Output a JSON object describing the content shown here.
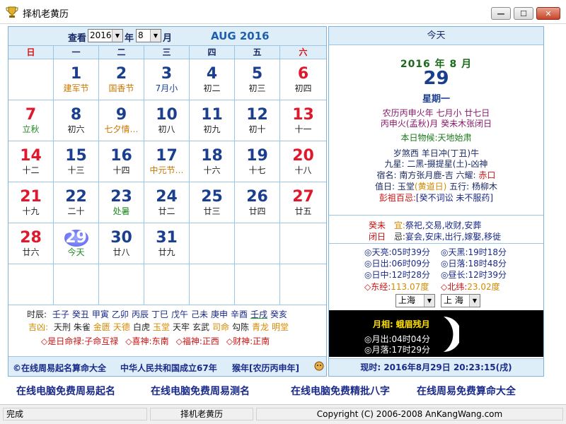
{
  "window": {
    "title": "择机老黄历",
    "min_glyph": "—",
    "max_glyph": "☐",
    "close_glyph": "✕"
  },
  "nav": {
    "view_label": "查看",
    "year_value": "2016",
    "year_unit": "年",
    "month_value": "8",
    "month_unit": "月",
    "month_title": "AUG 2016"
  },
  "weekdays": [
    "日",
    "一",
    "二",
    "三",
    "四",
    "五",
    "六"
  ],
  "calendar": [
    [
      {
        "d": "",
        "l": ""
      },
      {
        "d": "1",
        "l": "建军节",
        "k": "fest"
      },
      {
        "d": "2",
        "l": "国香节",
        "k": "fest"
      },
      {
        "d": "3",
        "l": "7月小",
        "k": "blue"
      },
      {
        "d": "4",
        "l": "初二"
      },
      {
        "d": "5",
        "l": "初三"
      },
      {
        "d": "6",
        "l": "初四"
      }
    ],
    [
      {
        "d": "7",
        "l": "立秋",
        "k": "term"
      },
      {
        "d": "8",
        "l": "初六"
      },
      {
        "d": "9",
        "l": "七夕情…",
        "k": "fest"
      },
      {
        "d": "10",
        "l": "初八"
      },
      {
        "d": "11",
        "l": "初九"
      },
      {
        "d": "12",
        "l": "初十"
      },
      {
        "d": "13",
        "l": "十一"
      }
    ],
    [
      {
        "d": "14",
        "l": "十二"
      },
      {
        "d": "15",
        "l": "十三"
      },
      {
        "d": "16",
        "l": "十四"
      },
      {
        "d": "17",
        "l": "中元节…",
        "k": "fest"
      },
      {
        "d": "18",
        "l": "十六"
      },
      {
        "d": "19",
        "l": "十七"
      },
      {
        "d": "20",
        "l": "十八"
      }
    ],
    [
      {
        "d": "21",
        "l": "十九"
      },
      {
        "d": "22",
        "l": "二十"
      },
      {
        "d": "23",
        "l": "处暑",
        "k": "term"
      },
      {
        "d": "24",
        "l": "廿二"
      },
      {
        "d": "25",
        "l": "廿三"
      },
      {
        "d": "26",
        "l": "廿四"
      },
      {
        "d": "27",
        "l": "廿五"
      }
    ],
    [
      {
        "d": "28",
        "l": "廿六"
      },
      {
        "d": "29",
        "l": "今天",
        "k": "term",
        "today": true
      },
      {
        "d": "30",
        "l": "廿八"
      },
      {
        "d": "31",
        "l": "廿九"
      },
      {
        "d": "",
        "l": ""
      },
      {
        "d": "",
        "l": ""
      },
      {
        "d": "",
        "l": ""
      }
    ],
    [
      {
        "d": "",
        "l": ""
      },
      {
        "d": "",
        "l": ""
      },
      {
        "d": "",
        "l": ""
      },
      {
        "d": "",
        "l": ""
      },
      {
        "d": "",
        "l": ""
      },
      {
        "d": "",
        "l": ""
      },
      {
        "d": "",
        "l": ""
      }
    ]
  ],
  "hours": {
    "row1_label": "时辰:",
    "row1": [
      "壬子",
      "癸丑",
      "甲寅",
      "乙卯",
      "丙辰",
      "丁巳",
      "戊午",
      "己未",
      "庚申",
      "辛酉",
      "壬戌",
      "癸亥"
    ],
    "row2_label": "吉凶:",
    "row2": [
      {
        "t": "天刑",
        "c": "dark"
      },
      {
        "t": "朱雀",
        "c": "dark"
      },
      {
        "t": "金匮",
        "c": "gold"
      },
      {
        "t": "天德",
        "c": "gold"
      },
      {
        "t": "白虎",
        "c": "dark"
      },
      {
        "t": "玉堂",
        "c": "gold"
      },
      {
        "t": "天牢",
        "c": "dark"
      },
      {
        "t": "玄武",
        "c": "dark"
      },
      {
        "t": "司命",
        "c": "gold"
      },
      {
        "t": "勾陈",
        "c": "dark"
      },
      {
        "t": "青龙",
        "c": "gold"
      },
      {
        "t": "明堂",
        "c": "gold"
      }
    ],
    "row3": [
      {
        "k": "◇是日命禄:",
        "v": "子命互禄"
      },
      {
        "k": "◇喜神:",
        "v": "东南"
      },
      {
        "k": "◇福神:",
        "v": "正西"
      },
      {
        "k": "◇财神:",
        "v": "正南"
      }
    ]
  },
  "left_footer": {
    "copy": "©在线周易起名算命大全",
    "mid": "中华人民共和国成立67年",
    "year": "猴年[农历丙申年]"
  },
  "today": {
    "header": "今天",
    "ym": "2016 年 8 月",
    "day": "29",
    "weekday": "星期一",
    "lunar1": "农历丙申火年  七月小  廿七日",
    "lunar2": "丙申火(孟秋)月  癸未木张闭日",
    "wuhou_label": "本日物候:",
    "wuhou_value": "天地始肃",
    "sui": "岁煞西  羊日冲(丁丑)牛",
    "jiuxing": "九星: 二黑-摄提星(土)-凶神",
    "xiu_label": "宿名: 南方张月鹿-吉 六耀: ",
    "xiu_value": "赤口",
    "zhi_a": "值日: 玉堂",
    "zhi_b": "(黄道日)",
    "zhi_c": " 五行: 杨柳木",
    "pengzu_label": "彭祖百忌:",
    "pengzu_value": "[癸不词讼 未不服药]",
    "yi_tag": "癸未",
    "yi_label": "宜:",
    "yi_value": "祭祀,交易,收财,安葬",
    "ji_tag": "闭日",
    "ji_label": "忌:",
    "ji_value": "宴会,安床,出行,嫁娶,移徙"
  },
  "sun": [
    {
      "k": "◎天亮:",
      "v": "05时39分"
    },
    {
      "k": "◎天黑:",
      "v": "19时18分"
    },
    {
      "k": "◎日出:",
      "v": "06时09分"
    },
    {
      "k": "◎日落:",
      "v": "18时48分"
    },
    {
      "k": "◎日中:",
      "v": "12时28分"
    },
    {
      "k": "◎昼长:",
      "v": "12时39分"
    }
  ],
  "coords": {
    "east_label": "◇东经:",
    "east_value": "113.07度",
    "north_label": "◇北纬:",
    "north_value": "23.02度"
  },
  "location": {
    "province": "上海",
    "city": "上 海"
  },
  "moon": {
    "phase_label": "月相:",
    "phase_value": "蛾眉残月",
    "rise_label": "◎月出:",
    "rise_value": "04时04分",
    "set_label": "◎月落:",
    "set_value": "17时29分"
  },
  "now": {
    "text": "现时: 2016年8月29日  20:23:15(戌)"
  },
  "links": [
    "在线电脑免费周易起名",
    "在线电脑免费周易测名",
    "在线电脑免费精批八字",
    "在线周易免费算命大全"
  ],
  "status": {
    "left": "完成",
    "mid": "择机老黄历",
    "right": "Copyright (C) 2006-2008 AnKangWang.com"
  },
  "colors": {
    "accent_blue": "#1f5fb0",
    "red": "#e0182e",
    "panel_bg": "#ddeef9",
    "gold": "#d48a00",
    "green": "#228822"
  }
}
